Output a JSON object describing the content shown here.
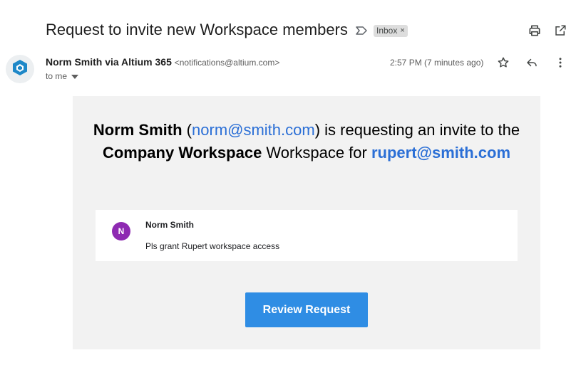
{
  "header": {
    "subject": "Request to invite new Workspace members",
    "label_chip": "Inbox",
    "label_chip_remove": "×"
  },
  "icons": {
    "label": "label-arrow-icon",
    "print": "print-icon",
    "popout": "open-in-new-window-icon",
    "star": "star-icon",
    "reply": "reply-icon",
    "more": "more-vertical-icon",
    "caret": "chevron-down-icon",
    "avatar": "altium-logo-icon"
  },
  "sender": {
    "name": "Norm Smith via Altium 365",
    "email": "<notifications@altium.com>",
    "to": "to me",
    "time": "2:57 PM (7 minutes ago)"
  },
  "body": {
    "requester_name": "Norm Smith",
    "open_paren": " (",
    "requester_email": "norm@smith.com",
    "phrase_1": ") is requesting an invite to the ",
    "workspace_name": "Company Workspace",
    "phrase_2": " Workspace for ",
    "invitee_email": "rupert@smith.com",
    "note": {
      "avatar_letter": "N",
      "author": "Norm Smith",
      "text": "Pls grant Rupert workspace access"
    },
    "button_label": "Review Request"
  },
  "colors": {
    "link": "#2b6fd6",
    "button": "#2f8de4",
    "card_bg": "#f2f2f2",
    "note_avatar": "#8e2ab2",
    "logo": "#1e88c8"
  }
}
